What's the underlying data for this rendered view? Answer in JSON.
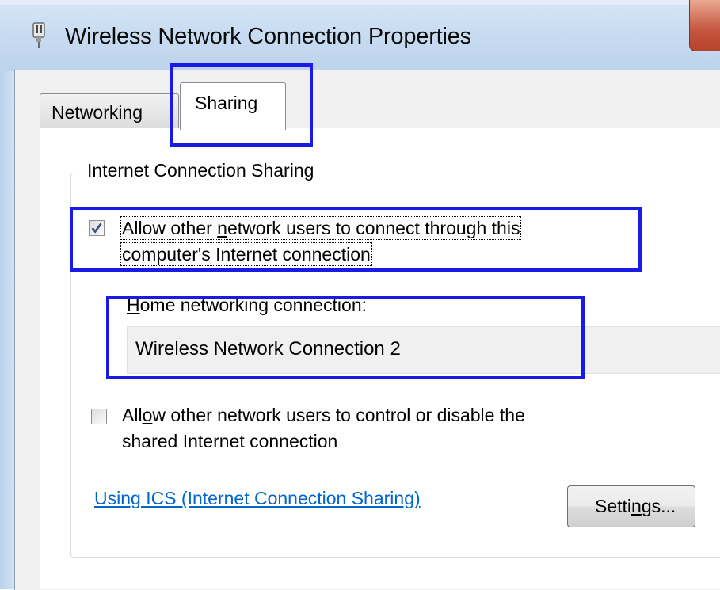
{
  "window": {
    "title": "Wireless Network Connection Properties",
    "icon": "network-adapter-icon"
  },
  "tabs": [
    {
      "label": "Networking",
      "active": false
    },
    {
      "label": "Sharing",
      "active": true
    }
  ],
  "ics": {
    "group_label": "Internet Connection Sharing",
    "allow_connect": {
      "checked": true,
      "line1_pre": "Allow other ",
      "line1_mnemonic": "n",
      "line1_post": "etwork users to connect through this",
      "line2": "computer's Internet connection"
    },
    "home_connection": {
      "label_mnemonic": "H",
      "label_rest": "ome networking connection:",
      "value": "Wireless Network Connection 2"
    },
    "allow_control": {
      "checked": false,
      "line1_pre": "All",
      "line1_mnemonic": "o",
      "line1_post": "w other network users to control or disable the",
      "line2": "shared Internet connection"
    },
    "help_link": "Using ICS (Internet Connection Sharing)",
    "settings_button": {
      "pre": "Setti",
      "mnemonic": "n",
      "post": "gs..."
    }
  },
  "colors": {
    "highlight": "#1a1ae6",
    "link": "#0066cc",
    "close_button": "#c4553e"
  }
}
